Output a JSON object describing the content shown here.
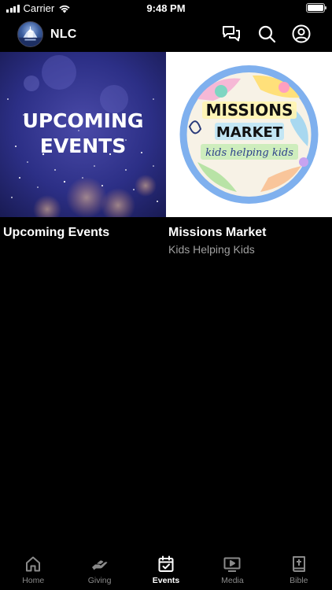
{
  "status_bar": {
    "carrier": "Carrier",
    "time": "9:48 PM"
  },
  "header": {
    "title": "NLC",
    "avatar_icon": "church-logo-icon",
    "icons": [
      "chat-icon",
      "search-icon",
      "profile-icon"
    ]
  },
  "cards": [
    {
      "image_text_line1": "UPCOMING",
      "image_text_line2": "EVENTS",
      "title": "Upcoming Events",
      "subtitle": ""
    },
    {
      "image_text_line1": "MISSIONS",
      "image_text_line2": "MARKET",
      "image_text_line3": "kids helping kids",
      "title": "Missions Market",
      "subtitle": "Kids Helping Kids"
    }
  ],
  "tabs": [
    {
      "label": "Home",
      "icon": "home-icon",
      "active": false
    },
    {
      "label": "Giving",
      "icon": "giving-hand-icon",
      "active": false
    },
    {
      "label": "Events",
      "icon": "calendar-check-icon",
      "active": true
    },
    {
      "label": "Media",
      "icon": "play-screen-icon",
      "active": false
    },
    {
      "label": "Bible",
      "icon": "bible-icon",
      "active": false
    }
  ],
  "colors": {
    "background": "#000000",
    "tab_inactive": "#8a8a8a",
    "tab_active": "#ffffff",
    "subtitle": "#a0a0a0"
  }
}
